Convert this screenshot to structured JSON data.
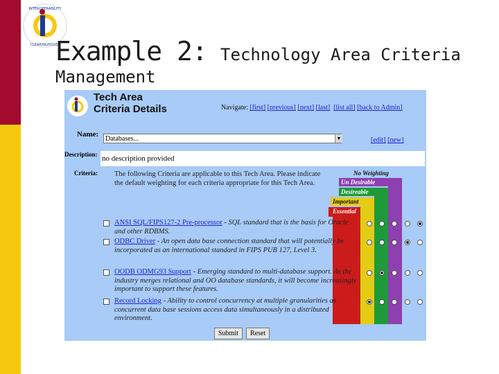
{
  "slide": {
    "title_main": "Example 2:",
    "title_rest": "Technology Area Criteria",
    "subtitle": "Management"
  },
  "logo": {
    "letters": "INTEROPERABILITY CLEARINGHOUSE",
    "letter": "ic",
    "colors": [
      "#1e3a8a",
      "#f6c90e",
      "#a30a2e"
    ]
  },
  "app": {
    "title_line1": "Tech Area",
    "title_line2": "Criteria Details",
    "nav_prefix": "Navigate:",
    "nav_links": [
      "[first]",
      "[previous]",
      "[next]",
      "[last]",
      "[list all]",
      "[back to Admin]"
    ],
    "name_label": "Name:",
    "name_value": "Databases...",
    "edit_link": "[edit]",
    "new_link": "[new]",
    "description_label": "Description:",
    "description_value": "no description provided",
    "criteria_label": "Criteria:",
    "intro_text": "The following Criteria are applicable to this Tech Area. Please indicate the default weighting for each criteria appropriate for this Tech Area.",
    "weights": [
      {
        "label": "No Weighting",
        "color": "#a8cbf7",
        "text_color": "#111111"
      },
      {
        "label": "Un Desirable",
        "color": "#8e3fb0",
        "text_color": "#ffffff"
      },
      {
        "label": "Desireable",
        "color": "#1e9a3a",
        "text_color": "#ffffff"
      },
      {
        "label": "Important",
        "color": "#e2cc16",
        "text_color": "#111111"
      },
      {
        "label": "Essential",
        "color": "#cc1b1b",
        "text_color": "#ffffff"
      }
    ],
    "criteria": [
      {
        "link": "ANSI SQL/FIPS127-2 Pre-processor",
        "description": " - SQL standard that is the basis for Oracle and other RDBMS.",
        "selected": 4
      },
      {
        "link": "ODBC Driver",
        "description": " - An open data base connection standard that will potentially be incorporated as an international standard in FIPS PUB 127, Level 3.",
        "selected": 3
      },
      {
        "link": "OODB ODMG93 Support",
        "description": " - Emerging standard to multi-database support. As the industry merges relational and OO database standards, it will become increasingly important to support these features.",
        "selected": 1
      },
      {
        "link": "Record Locking",
        "description": " - Ability to control concurrency at multiple granularities as concurrent data base sessions access data simultaneously in a distributed environment.",
        "selected": 0
      }
    ],
    "submit_label": "Submit",
    "reset_label": "Reset"
  }
}
